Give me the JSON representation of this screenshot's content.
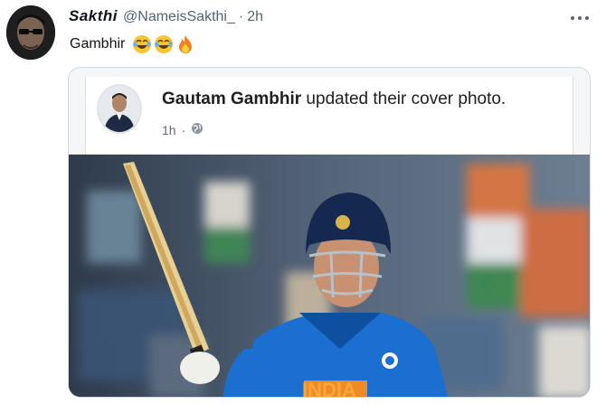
{
  "tweet": {
    "display_name": "Sakthi",
    "handle": "@NameisSakthi_",
    "separator": "·",
    "time": "2h",
    "text": "Gambhir",
    "emojis": [
      "joy-emoji",
      "joy-emoji",
      "fire-emoji"
    ]
  },
  "quoted_post": {
    "author": "Gautam Gambhir",
    "action": " updated their cover photo.",
    "time": "1h",
    "separator": "·",
    "privacy_icon": "globe-icon"
  },
  "cover_photo": {
    "jersey_text": "INDIA"
  },
  "icons": {
    "more": "more-horizontal-icon"
  },
  "colors": {
    "text_primary": "#0f1419",
    "text_secondary": "#536471",
    "card_border": "#cfd9de",
    "jersey_blue": "#1b6fd0"
  }
}
